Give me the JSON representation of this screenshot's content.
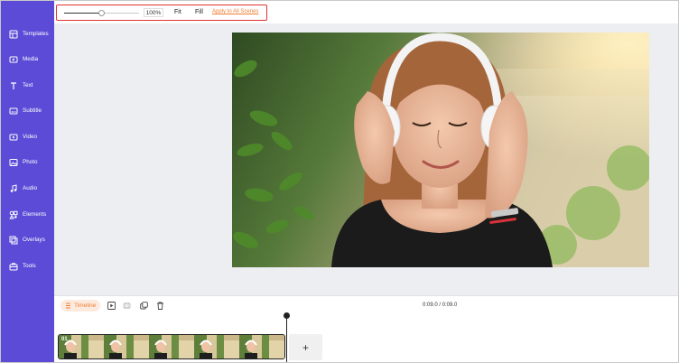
{
  "sidebar": {
    "items": [
      {
        "label": "Templates",
        "icon": "templates-icon"
      },
      {
        "label": "Media",
        "icon": "media-icon"
      },
      {
        "label": "Text",
        "icon": "text-icon"
      },
      {
        "label": "Subtitle",
        "icon": "subtitle-icon"
      },
      {
        "label": "Video",
        "icon": "video-icon"
      },
      {
        "label": "Photo",
        "icon": "photo-icon"
      },
      {
        "label": "Audio",
        "icon": "audio-icon"
      },
      {
        "label": "Elements",
        "icon": "elements-icon"
      },
      {
        "label": "Overlays",
        "icon": "overlays-icon"
      },
      {
        "label": "Tools",
        "icon": "tools-icon"
      }
    ],
    "color": "#5b4bd6"
  },
  "toolbar": {
    "zoom_value": "100%",
    "zoom_level": 0.5,
    "fit_label": "Fit",
    "fill_label": "Fill",
    "apply_label": "Apply to All Scenes",
    "highlight_color": "#e03434",
    "accent_color": "#f07d33"
  },
  "timeline": {
    "tab_label": "Timeline",
    "time_display": "0:09.0 / 0:09.0",
    "clip_number": "01",
    "add_label": "+"
  }
}
